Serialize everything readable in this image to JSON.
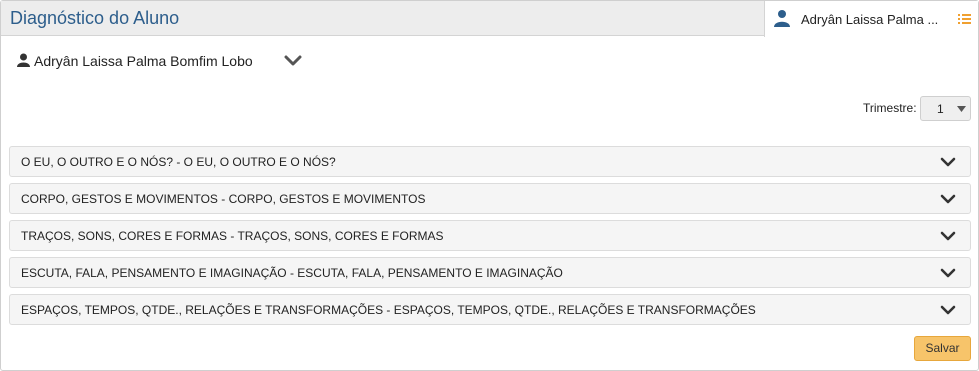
{
  "header": {
    "title": "Diagnóstico do Aluno",
    "user_tab_name": "Adryân Laissa Palma ...",
    "user_icon": "user-icon",
    "list_icon": "list-icon",
    "accent_color": "#2d5e8c"
  },
  "student": {
    "name": "Adryân Laissa Palma Bomfim Lobo",
    "icon": "user-icon",
    "toggle_icon": "chevron-down-icon"
  },
  "trimestre": {
    "label": "Trimestre:",
    "selected": "1"
  },
  "panels": [
    {
      "label": "O EU, O OUTRO E O NÓS? - O EU, O OUTRO E O NÓS?"
    },
    {
      "label": "CORPO, GESTOS E MOVIMENTOS - CORPO, GESTOS E MOVIMENTOS"
    },
    {
      "label": "TRAÇOS, SONS, CORES E FORMAS - TRAÇOS, SONS, CORES E FORMAS"
    },
    {
      "label": "ESCUTA, FALA, PENSAMENTO E IMAGINAÇÃO - ESCUTA, FALA, PENSAMENTO E IMAGINAÇÃO"
    },
    {
      "label": "ESPAÇOS, TEMPOS, QTDE., RELAÇÕES E TRANSFORMAÇÕES - ESPAÇOS, TEMPOS, QTDE., RELAÇÕES E TRANSFORMAÇÕES"
    }
  ],
  "actions": {
    "save_label": "Salvar",
    "save_color": "#f7c46a"
  }
}
